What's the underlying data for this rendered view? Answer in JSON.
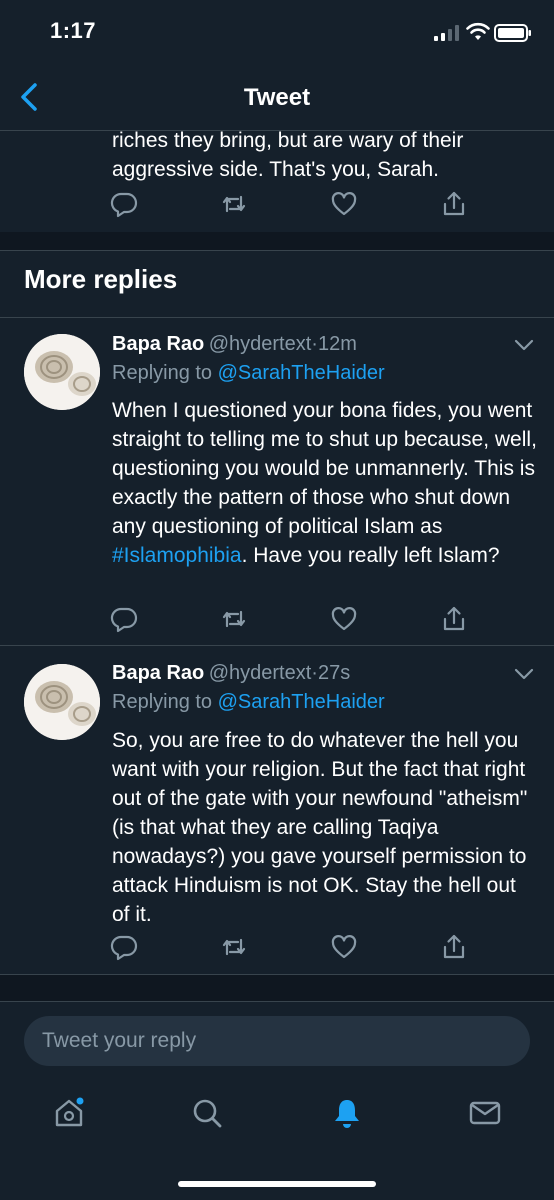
{
  "status_bar": {
    "time": "1:17"
  },
  "header": {
    "title": "Tweet",
    "back_icon": "chevron-left-icon"
  },
  "previous_tweet": {
    "text": "riches they bring, but are wary of their aggressive side. That's you, Sarah."
  },
  "section": {
    "title": "More replies"
  },
  "replies": [
    {
      "name": "Bapa Rao",
      "handle": "@hydertext",
      "time": "12m",
      "replying_prefix": "Replying to",
      "replying_to": "@SarahTheHaider",
      "text_before": "When I questioned your bona fides, you went straight to telling me to shut up because, well, questioning you would be unmannerly. This is exactly the pattern of those who shut down any questioning of political Islam as ",
      "hashtag": "#Islamophibia",
      "text_after": ". Have you really left Islam?"
    },
    {
      "name": "Bapa Rao",
      "handle": "@hydertext",
      "time": "27s",
      "replying_prefix": "Replying to",
      "replying_to": "@SarahTheHaider",
      "text": "So, you are free to do whatever the hell you want with your religion. But the fact that right out of the gate with your newfound \"atheism\" (is that what they are calling Taqiya nowadays?) you gave yourself permission to attack Hinduism is not OK. Stay the hell out of it."
    }
  ],
  "reply_input": {
    "placeholder": "Tweet your reply"
  },
  "colors": {
    "background": "#15202b",
    "accent": "#1da1f2",
    "muted_text": "#8899a6",
    "divider": "#38444d"
  },
  "icons": {
    "actions": [
      "reply-icon",
      "retweet-icon",
      "like-icon",
      "share-icon"
    ],
    "tabs": [
      "home-icon",
      "search-icon",
      "notifications-icon",
      "messages-icon"
    ]
  }
}
